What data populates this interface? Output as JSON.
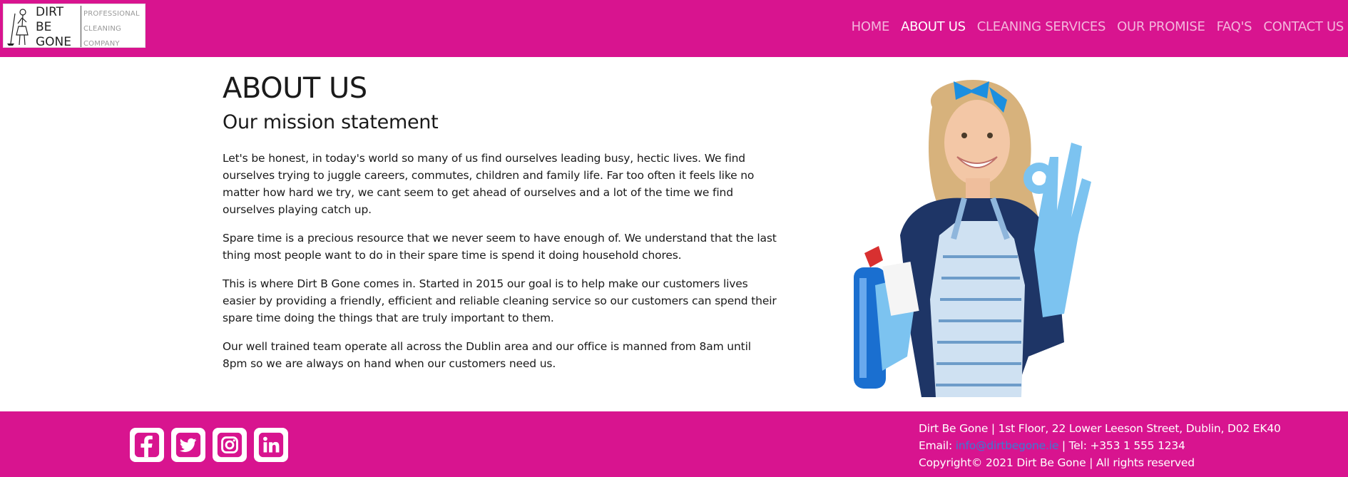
{
  "colors": {
    "brand": "#d8148f",
    "nav_inactive": "#f4b6dc",
    "nav_active": "#ffffff",
    "link": "#3a7bd5"
  },
  "logo": {
    "main_lines": [
      "DIRT",
      "BE",
      "GONE"
    ],
    "sub_lines": [
      "PROFESSIONAL",
      "CLEANING",
      "COMPANY"
    ],
    "icon": "cleaning-lady-figure-icon"
  },
  "nav": {
    "items": [
      {
        "label": "HOME",
        "active": false
      },
      {
        "label": "ABOUT US",
        "active": true
      },
      {
        "label": "CLEANING SERVICES",
        "active": false
      },
      {
        "label": "OUR PROMISE",
        "active": false
      },
      {
        "label": "FAQ'S",
        "active": false
      },
      {
        "label": "CONTACT US",
        "active": false
      }
    ]
  },
  "main": {
    "title": "ABOUT US",
    "subtitle": "Our mission statement",
    "paragraphs": [
      "Let's be honest, in today's world so many of us find ourselves leading busy, hectic lives. We find ourselves trying to juggle careers, commutes, children and family life. Far too often it feels like no matter how hard we try, we cant seem to get ahead of ourselves and a lot of the time we find ourselves playing catch up.",
      "Spare time is a precious resource that we never seem to have enough of. We understand that the last thing most people want to do in their spare time is spend it doing household chores.",
      "This is where Dirt B Gone comes in. Started in 2015 our goal is to help make our customers lives easier by providing a friendly, efficient and reliable cleaning service so our customers can spend their spare time doing the things that are truly important to them.",
      "Our well trained team operate all across the Dublin area and our office is manned from 8am until 8pm so we are always on hand when our customers need us."
    ],
    "hero_image": "smiling-cleaner-with-spray-bottle-ok-gesture"
  },
  "footer": {
    "socials": [
      {
        "name": "facebook-icon"
      },
      {
        "name": "twitter-icon"
      },
      {
        "name": "instagram-icon"
      },
      {
        "name": "linkedin-icon"
      }
    ],
    "address": "Dirt Be Gone | 1st Floor, 22 Lower Leeson Street, Dublin, D02 EK40",
    "email_label": "Email: ",
    "email": "info@dirtbegone.ie",
    "phone": " | Tel: +353 1 555 1234",
    "copyright": "Copyright© 2021 Dirt Be Gone | All rights reserved"
  }
}
